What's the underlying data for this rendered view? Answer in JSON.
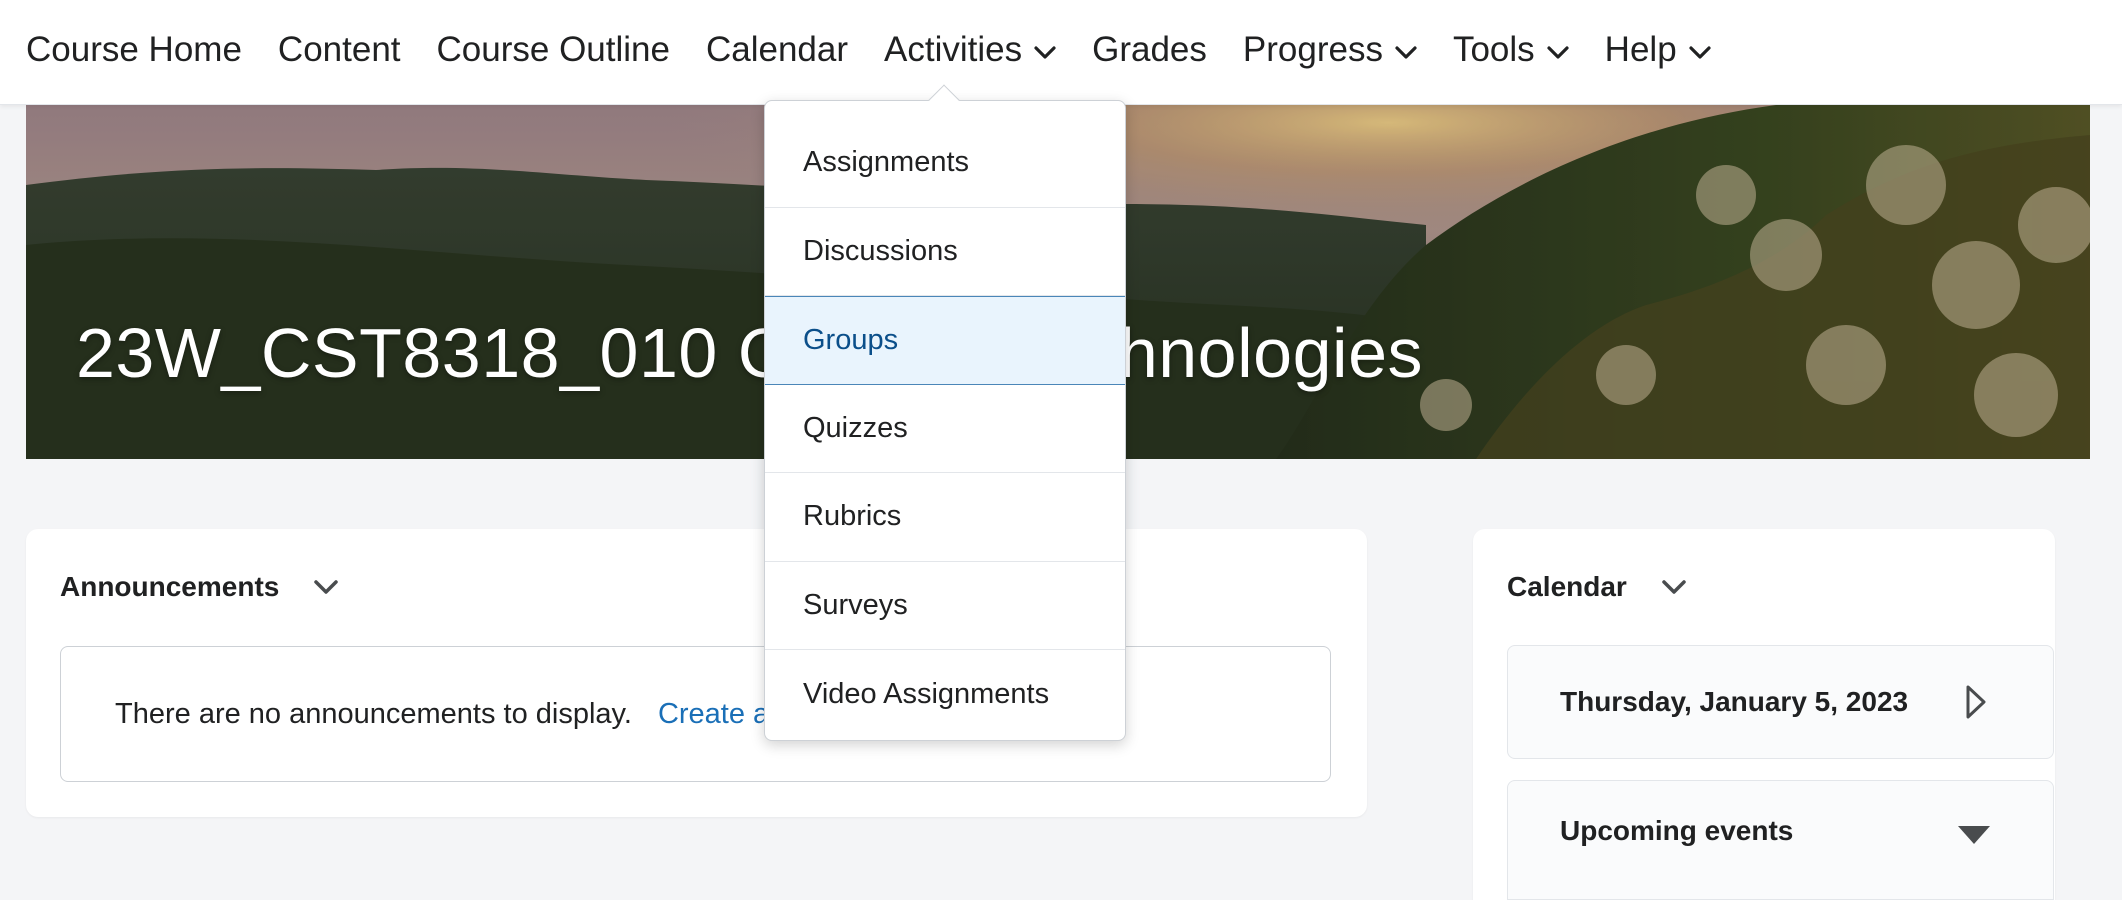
{
  "nav": {
    "items": [
      {
        "label": "Course Home",
        "has_dropdown": false
      },
      {
        "label": "Content",
        "has_dropdown": false
      },
      {
        "label": "Course Outline",
        "has_dropdown": false
      },
      {
        "label": "Calendar",
        "has_dropdown": false
      },
      {
        "label": "Activities",
        "has_dropdown": true,
        "expanded": true
      },
      {
        "label": "Grades",
        "has_dropdown": false
      },
      {
        "label": "Progress",
        "has_dropdown": true
      },
      {
        "label": "Tools",
        "has_dropdown": true
      },
      {
        "label": "Help",
        "has_dropdown": true
      }
    ]
  },
  "banner": {
    "title": "23W_CST8318_010 C",
    "title_tail": "hnologies"
  },
  "activities_menu": {
    "items": [
      {
        "label": "Assignments",
        "active": false
      },
      {
        "label": "Discussions",
        "active": false
      },
      {
        "label": "Groups",
        "active": true
      },
      {
        "label": "Quizzes",
        "active": false
      },
      {
        "label": "Rubrics",
        "active": false
      },
      {
        "label": "Surveys",
        "active": false
      },
      {
        "label": "Video Assignments",
        "active": false
      }
    ]
  },
  "announcements": {
    "title": "Announcements",
    "empty_message": "There are no announcements to display.",
    "create_link": "Create an"
  },
  "calendar": {
    "title": "Calendar",
    "date": "Thursday, January 5, 2023",
    "upcoming_label": "Upcoming events"
  },
  "colors": {
    "link": "#1a6fb7",
    "active_bg": "#e9f4fd",
    "active_text": "#0b4f8a",
    "page_bg": "#f4f5f7"
  }
}
